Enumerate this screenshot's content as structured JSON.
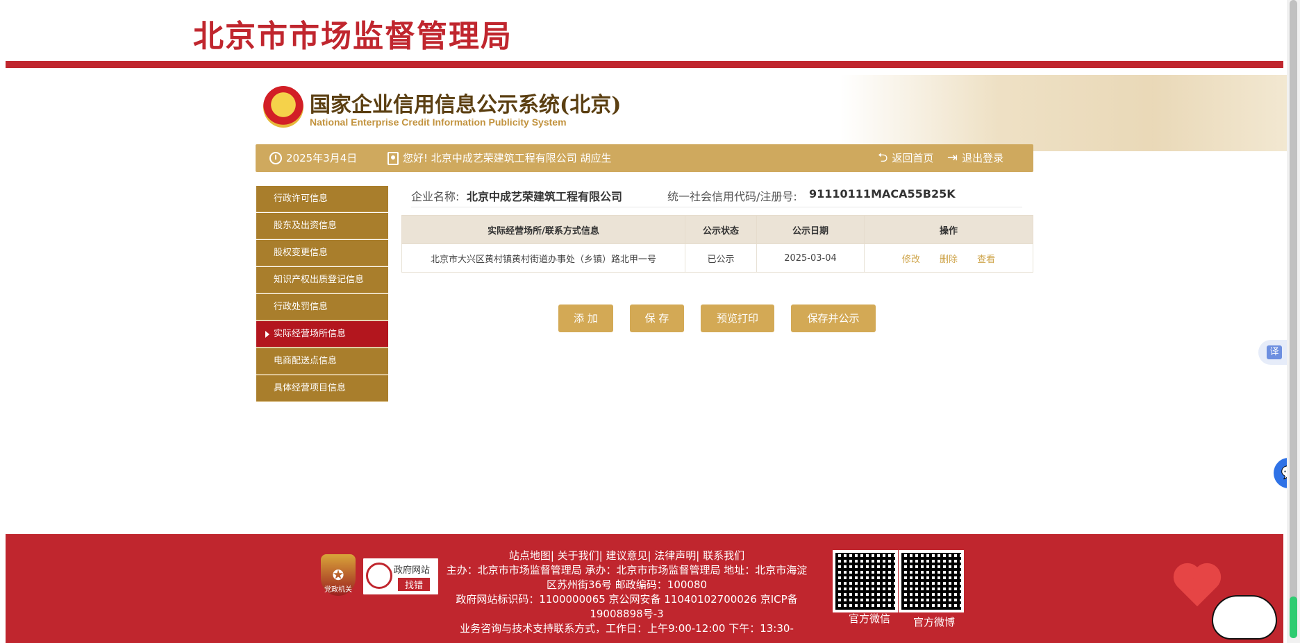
{
  "banner": {
    "title": "北京市市场监督管理局"
  },
  "system": {
    "title": "国家企业信用信息公示系统(北京)",
    "subtitle": "National Enterprise Credit Information Publicity System"
  },
  "infobar": {
    "date": "2025年3月4日",
    "greeting": "您好!  北京中成艺荣建筑工程有限公司  胡应生",
    "home": "返回首页",
    "logout": "退出登录"
  },
  "sidenav": [
    "行政许可信息",
    "股东及出资信息",
    "股权变更信息",
    "知识产权出质登记信息",
    "行政处罚信息",
    "实际经营场所信息",
    "电商配送点信息",
    "具体经营项目信息"
  ],
  "company": {
    "name_label": "企业名称:",
    "name": "北京中成艺荣建筑工程有限公司",
    "code_label": "统一社会信用代码/注册号:",
    "code": "91110111MACA55B25K"
  },
  "table": {
    "headers": [
      "实际经营场所/联系方式信息",
      "公示状态",
      "公示日期",
      "操作"
    ],
    "rows": [
      {
        "address": "北京市大兴区黄村镇黄村街道办事处（乡镇）路北甲一号",
        "status": "已公示",
        "date": "2025-03-04",
        "ops": [
          "修改",
          "删除",
          "查看"
        ]
      }
    ]
  },
  "buttons": {
    "add": "添 加",
    "save": "保 存",
    "preview": "预览打印",
    "save_publish": "保存并公示"
  },
  "translate_label": "译",
  "footer": {
    "links": "站点地图| 关于我们| 建议意见| 法律声明| 联系我们",
    "line1": "主办：北京市市场监督管理局 承办：北京市市场监督管理局 地址：北京市海淀区苏州街36号 邮政编码：100080",
    "line2": "政府网站标识码：1100000065    京公网安备 11040102700026    京ICP备19008898号-3",
    "line3": "业务咨询与技术支持联系方式，工作日：上午9:00-12:00 下午：13:30-",
    "badge1": "党政机关",
    "badge2_top": "政府网站",
    "badge2_bottom": "找错",
    "wechat": "官方微信",
    "weibo": "官方微博"
  },
  "colors": {
    "brand_red": "#c0262e",
    "gold": "#cfa95e",
    "nav_gold": "#a97e2c",
    "nav_active": "#b3161e"
  }
}
